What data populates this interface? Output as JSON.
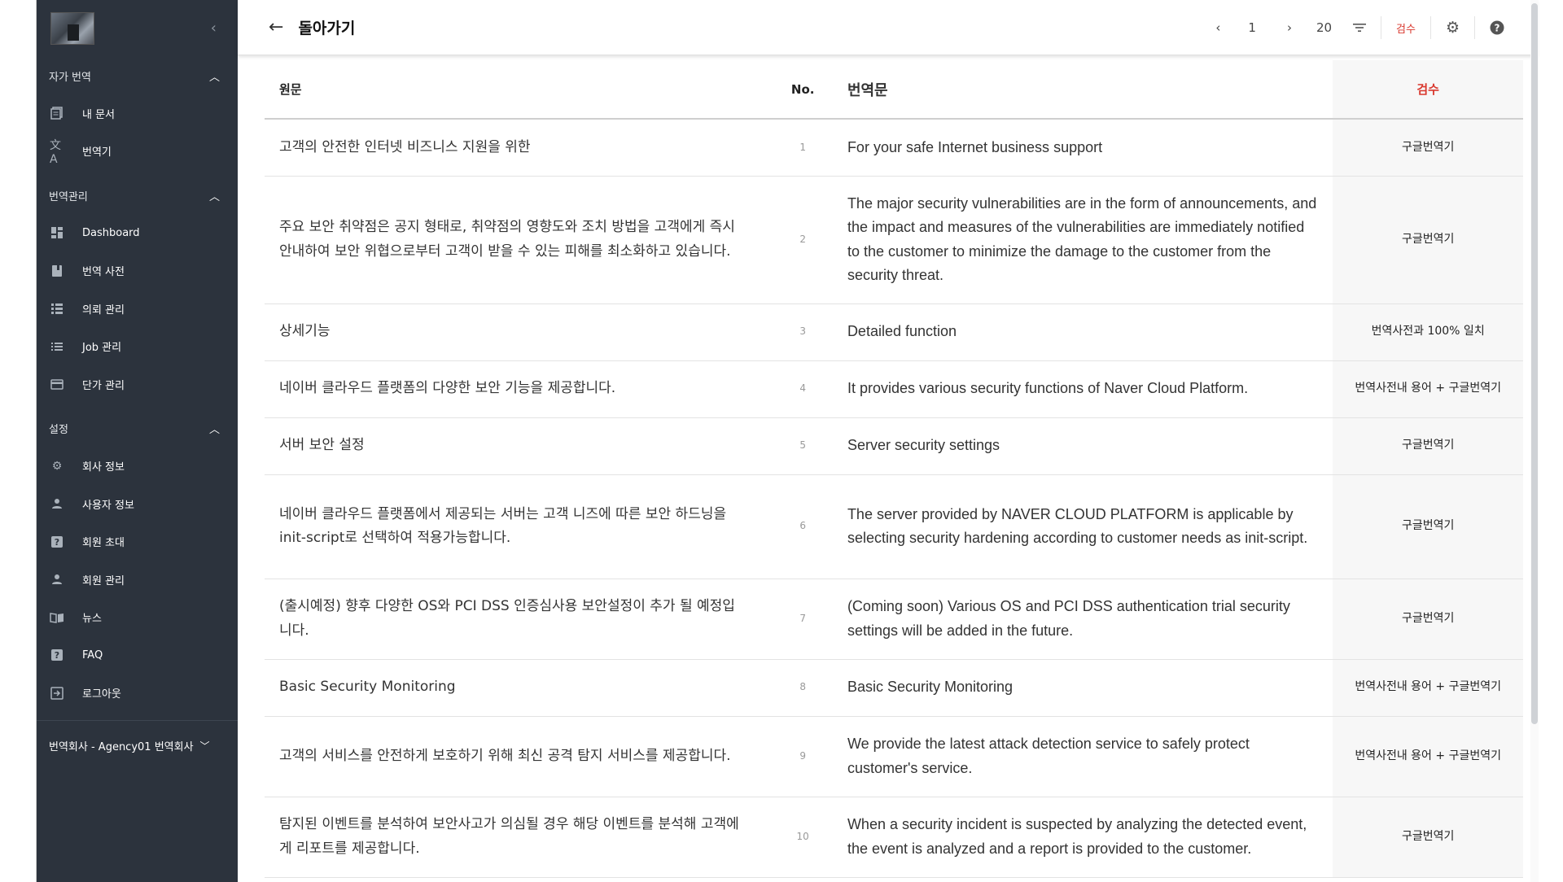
{
  "sidebar": {
    "collapse_icon": "chevron-left-icon",
    "sections": {
      "auto_translate": {
        "title": "자가 번역",
        "items": [
          {
            "label": "내 문서",
            "icon": "document-icon"
          },
          {
            "label": "번역기",
            "icon": "translate-icon"
          }
        ]
      },
      "management": {
        "title": "번역관리",
        "items": [
          {
            "label": "Dashboard",
            "icon": "dashboard-icon"
          },
          {
            "label": "번역 사전",
            "icon": "book-icon"
          },
          {
            "label": "의뢰 관리",
            "icon": "list-icon"
          },
          {
            "label": "Job 관리",
            "icon": "list-lines-icon"
          },
          {
            "label": "단가 관리",
            "icon": "card-icon"
          }
        ]
      },
      "settings": {
        "title": "설정",
        "items": [
          {
            "label": "회사 정보",
            "icon": "gear-icon"
          },
          {
            "label": "사용자 정보",
            "icon": "person-icon"
          },
          {
            "label": "회원 초대",
            "icon": "help-box-icon"
          },
          {
            "label": "회원 관리",
            "icon": "person-icon"
          },
          {
            "label": "뉴스",
            "icon": "open-book-icon"
          },
          {
            "label": "FAQ",
            "icon": "help-box-icon"
          },
          {
            "label": "로그아웃",
            "icon": "logout-icon"
          }
        ]
      }
    },
    "agency": "번역회사 - Agency01 번역회사"
  },
  "topbar": {
    "back_label": "돌아가기",
    "page": "1",
    "page_size": "20",
    "review_label": "검수"
  },
  "table": {
    "headers": {
      "source": "원문",
      "no": "No.",
      "target": "번역문",
      "review": "검수"
    },
    "rows": [
      {
        "source": "고객의 안전한 인터넷 비즈니스 지원을 위한",
        "no": "1",
        "target": "For your safe Internet business support",
        "review": "구글번역기"
      },
      {
        "source": "주요 보안 취약점은 공지 형태로, 취약점의 영향도와 조치 방법을 고객에게 즉시 안내하여 보안 위협으로부터 고객이 받을 수 있는 피해를 최소화하고 있습니다.",
        "no": "2",
        "target": "The major security vulnerabilities are in the form of announcements, and the impact and measures of the vulnerabilities are immediately notified to the customer to minimize the damage to the customer from the security threat.",
        "review": "구글번역기"
      },
      {
        "source": "상세기능",
        "no": "3",
        "target": "Detailed function",
        "review": "번역사전과 100% 일치"
      },
      {
        "source": "네이버 클라우드 플랫폼의 다양한 보안 기능을 제공합니다.",
        "no": "4",
        "target": "It provides various security functions of Naver Cloud Platform.",
        "review": "번역사전내 용어 + 구글번역기"
      },
      {
        "source": "서버 보안 설정",
        "no": "5",
        "target": "Server security settings",
        "review": "구글번역기"
      },
      {
        "source": "네이버 클라우드 플랫폼에서 제공되는 서버는 고객 니즈에 따른 보안 하드닝을 init-script로 선택하여 적용가능합니다.",
        "no": "6",
        "target": "The server provided by NAVER CLOUD PLATFORM is applicable by selecting security hardening according to customer needs as init-script.",
        "review": "구글번역기"
      },
      {
        "source": "(출시예정) 향후 다양한 OS와 PCI DSS 인증심사용 보안설정이 추가 될 예정입니다.",
        "no": "7",
        "target": "(Coming soon) Various OS and PCI DSS authentication trial security settings will be added in the future.",
        "review": "구글번역기"
      },
      {
        "source": "Basic Security Monitoring",
        "no": "8",
        "target": "Basic Security Monitoring",
        "review": "번역사전내 용어 + 구글번역기"
      },
      {
        "source": "고객의 서비스를 안전하게 보호하기 위해 최신 공격 탐지 서비스를 제공합니다.",
        "no": "9",
        "target": "We provide the latest attack detection service to safely protect customer's service.",
        "review": "번역사전내 용어 + 구글번역기"
      },
      {
        "source": "탐지된 이벤트를 분석하여 보안사고가 의심될 경우 해당 이벤트를 분석해 고객에게 리포트를 제공합니다.",
        "no": "10",
        "target": "When a security incident is suspected by analyzing the detected event, the event is analyzed and a report is provided to the customer.",
        "review": "구글번역기"
      }
    ]
  }
}
